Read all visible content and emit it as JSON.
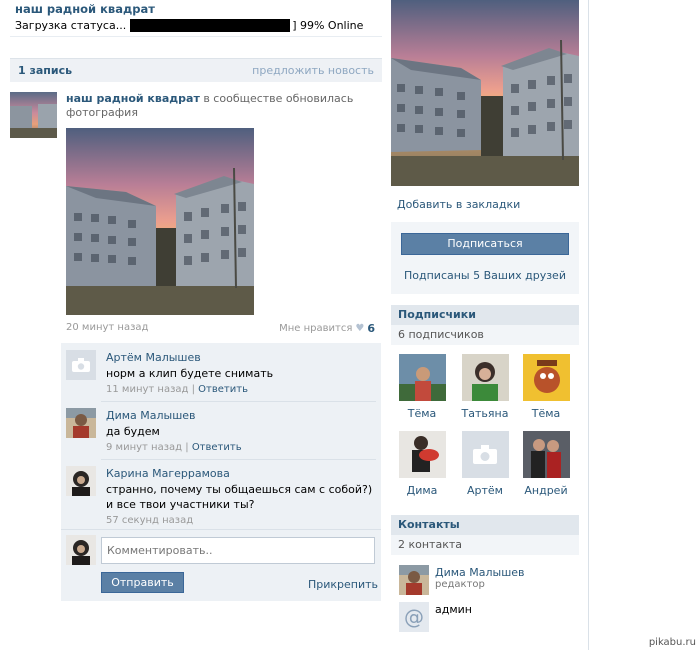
{
  "group": {
    "title": "наш радной квадрат",
    "status_prefix": "Загрузка статуса...",
    "status_suffix": "] 99% Online"
  },
  "wall": {
    "count": "1 запись",
    "suggest": "предложить новость"
  },
  "post": {
    "author": "наш радной квадрат",
    "action": "в сообществе обновилась фотография",
    "time": "20 минут назад",
    "like_label": "Мне нравится",
    "like_count": "6"
  },
  "comments": [
    {
      "name": "Артём Малышев",
      "text": "норм а клип будете снимать",
      "time": "11 минут назад",
      "reply": "Ответить"
    },
    {
      "name": "Дима Малышев",
      "text": "да будем",
      "time": "9 минут назад",
      "reply": "Ответить"
    },
    {
      "name": "Карина Магеррамова",
      "text": "странно, почему ты общаешься сам с собой?) и все твои участники ты?",
      "time": "57 секунд назад"
    }
  ],
  "reply_box": {
    "placeholder": "Комментировать..",
    "send": "Отправить",
    "attach": "Прикрепить"
  },
  "sidebar": {
    "bookmark": "Добавить в закладки",
    "subscribe": "Подписаться",
    "friends_subscribed": "Подписаны 5 Ваших друзей",
    "followers_title": "Подписчики",
    "followers_count": "6 подписчиков",
    "followers": [
      {
        "name": "Тёма"
      },
      {
        "name": "Татьяна"
      },
      {
        "name": "Тёма"
      },
      {
        "name": "Дима"
      },
      {
        "name": "Артём"
      },
      {
        "name": "Андрей"
      }
    ],
    "contacts_title": "Контакты",
    "contacts_count": "2 контакта",
    "contacts": [
      {
        "name": "Дима Малышев",
        "role": "редактор"
      },
      {
        "name": "админ",
        "role": ""
      }
    ]
  },
  "watermark": "pikabu.ru",
  "colors": {
    "link": "#2b587a",
    "button": "#5b80a5",
    "header_bg": "#e1e7ed"
  }
}
